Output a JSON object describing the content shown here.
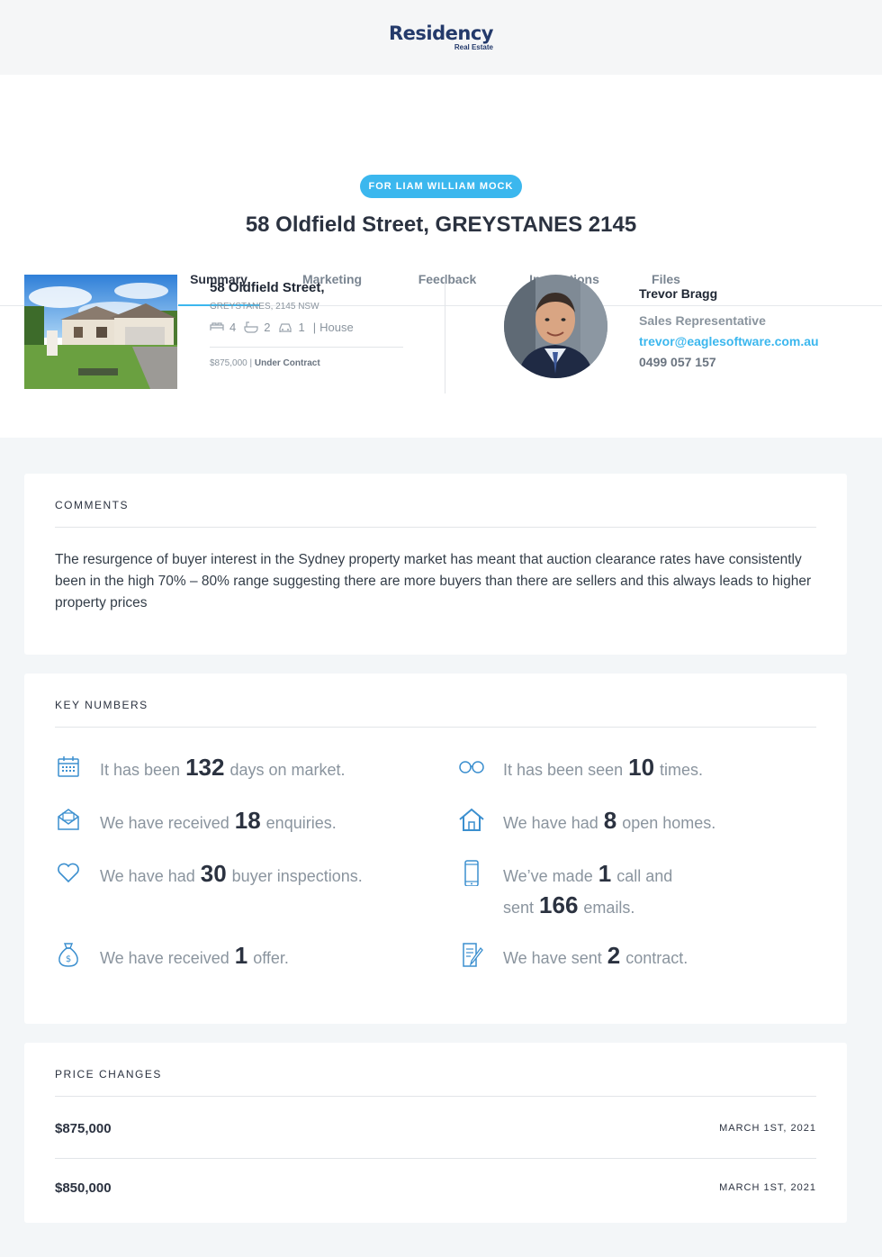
{
  "brand": {
    "name": "Residency",
    "sub": "Real Estate"
  },
  "badge": "FOR LIAM WILLIAM MOCK",
  "page_title": "58 Oldfield Street, GREYSTANES 2145",
  "tabs": [
    "Summary",
    "Marketing",
    "Feedback",
    "Inspections",
    "Files"
  ],
  "active_tab": "Summary",
  "property": {
    "street": "58 Oldfield Street,",
    "suburb": "GREYSTANES, 2145 NSW",
    "beds": "4",
    "baths": "2",
    "cars": "1",
    "separator": "|",
    "type": "House",
    "price": "$875,000 |",
    "status": "Under Contract"
  },
  "agent": {
    "name": "Trevor Bragg",
    "role": "Sales Representative",
    "email": "trevor@eaglesoftware.com.au",
    "phone": "0499 057 157"
  },
  "comments": {
    "title": "COMMENTS",
    "text": "The resurgence of buyer interest in the Sydney property market has meant that auction clearance rates have consistently been in the high 70% – 80% range suggesting there are more buyers than there are sellers and this always leads to higher property prices"
  },
  "key_numbers": {
    "title": "KEY NUMBERS",
    "days": {
      "pre": "It has been",
      "num": "132",
      "post": "days on market."
    },
    "seen": {
      "pre": "It has been seen",
      "num": "10",
      "post": "times."
    },
    "enquiries": {
      "pre": "We have received",
      "num": "18",
      "post": "enquiries."
    },
    "open_homes": {
      "pre": "We have had",
      "num": "8",
      "post": "open homes."
    },
    "inspections": {
      "pre": "We have had",
      "num": "30",
      "post": "buyer inspections."
    },
    "calls": {
      "pre": "We’ve made",
      "num": "1",
      "mid": "call and sent",
      "num2": "166",
      "post": "emails."
    },
    "offers": {
      "pre": "We have received",
      "num": "1",
      "post": "offer."
    },
    "contracts": {
      "pre": "We have sent",
      "num": "2",
      "post": "contract."
    }
  },
  "price_changes": {
    "title": "PRICE CHANGES",
    "rows": [
      {
        "price": "$875,000",
        "date": "MARCH 1ST, 2021"
      },
      {
        "price": "$850,000",
        "date": "MARCH 1ST, 2021"
      }
    ]
  },
  "colors": {
    "accent": "#3bb7ee",
    "brand": "#243a6b",
    "icon": "#3b8fcf"
  }
}
